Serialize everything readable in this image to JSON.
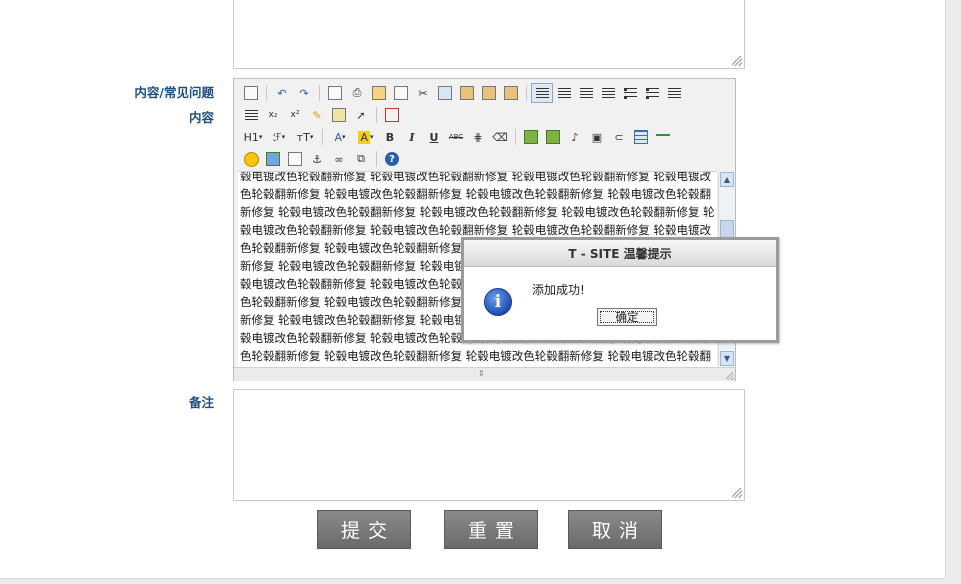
{
  "form": {
    "labels": {
      "category": "内容/常见问题",
      "content": "内容",
      "note": "备注"
    },
    "content_text": "毂电镀改色轮毂翻新修复 轮毂电镀改色轮毂翻新修复 轮毂电镀改色轮毂翻新修复 轮毂电镀改色轮毂翻新修复 轮毂电镀改色轮毂翻新修复 轮毂电镀改色轮毂翻新修复 轮毂电镀改色轮毂翻新修复 轮毂电镀改色轮毂翻新修复 轮毂电镀改色轮毂翻新修复 轮毂电镀改色轮毂翻新修复 轮毂电镀改色轮毂翻新修复 轮毂电镀改色轮毂翻新修复 轮毂电镀改色轮毂翻新修复 轮毂电镀改色轮毂翻新修复 轮毂电镀改色轮毂翻新修复 轮毂电镀改色轮毂翻新修复 轮毂电镀改色轮毂翻新修复 轮毂电镀改色轮毂翻新修复 轮毂电镀改色轮毂翻新修复 轮毂电镀改色轮毂翻新修复 轮毂电镀改色轮毂翻新修复 轮毂电镀改色轮毂翻新修复 轮毂电镀改色轮毂翻新修复 轮毂电镀改色轮毂翻新修复 轮毂电镀改色轮毂翻新修复 轮毂电镀改色轮毂翻新修复 轮毂电镀改色轮毂翻新修复 轮毂电镀改色轮毂翻新修复 轮毂电镀改色轮毂翻新修复 轮毂电镀改色轮毂翻新修复 轮毂电镀改色轮毂翻新修复 轮毂电镀改色轮毂翻新修复 轮毂电镀改色轮毂翻新修复 轮毂电镀改色轮毂翻新修复 轮毂电镀改色轮毂翻新修复 轮毂电镀改色轮毂翻新修复 轮毂电镀改色轮毂翻新修复 轮毂电镀改色轮毂翻新修复 轮毂电镀改色轮毂翻新修复 轮毂电镀改色轮毂翻新修复 轮毂电镀改色轮毂翻新修",
    "toolbar": {
      "h1_label": "H1",
      "font_label": "ℱ",
      "size_label": "тT",
      "fontcolor_label": "A",
      "highlight_label": "A",
      "bold_label": "B",
      "italic_label": "I",
      "underline_label": "U",
      "strike_label": "ABC",
      "sub_label": "x₂",
      "sup_label": "x²"
    }
  },
  "buttons": {
    "submit": "提交",
    "reset": "重置",
    "cancel": "取消"
  },
  "dialog": {
    "title": "T - SITE 温馨提示",
    "message": "添加成功!",
    "ok": "确定",
    "icon_glyph": "i"
  },
  "colors": {
    "label_blue": "#1d4f86",
    "button_gray": "#777777"
  }
}
